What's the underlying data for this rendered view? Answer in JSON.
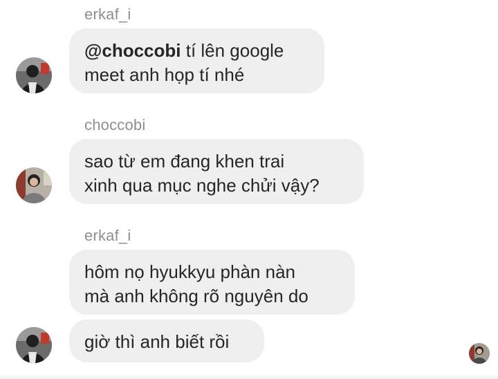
{
  "messages": [
    {
      "sender": "erkaf_i",
      "mention": "@choccobi",
      "lines": [
        "tí lên google",
        "meet anh họp tí nhé"
      ]
    },
    {
      "sender": "choccobi",
      "lines": [
        "sao từ em đang khen trai",
        "xinh qua mục nghe chửi vậy?"
      ]
    },
    {
      "sender": "erkaf_i",
      "lines": [
        "hôm nọ hyukkyu phàn nàn",
        "mà anh không rõ nguyên do"
      ]
    },
    {
      "lines": [
        "giờ thì anh biết rồi"
      ]
    }
  ],
  "icons": {
    "avatar_erkaf": "user-avatar-icon",
    "avatar_choccobi": "user-avatar-icon",
    "read_receipt": "seen-avatar-icon"
  }
}
